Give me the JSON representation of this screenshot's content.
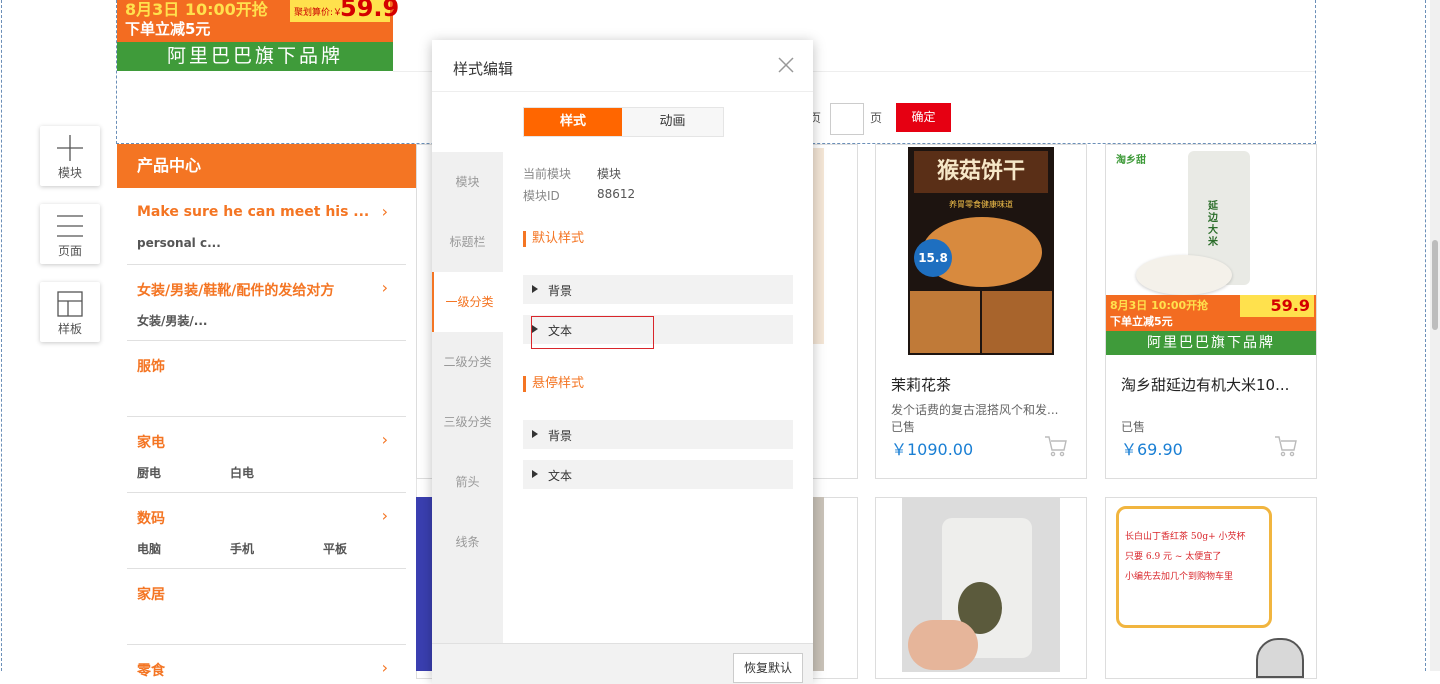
{
  "tools": [
    {
      "label": "模块",
      "icon": "plus-icon"
    },
    {
      "label": "页面",
      "icon": "page-lines-icon"
    },
    {
      "label": "样板",
      "icon": "layout-grid-icon"
    }
  ],
  "banner": {
    "line1": "8月3日 10:00开抢",
    "line2": "下单立减5元",
    "price_tag": "聚划算价:￥",
    "price": "59.9",
    "brand": "阿里巴巴旗下品牌"
  },
  "pager": {
    "suffix_char": "页",
    "unit": "页",
    "confirm": "确定",
    "input_value": ""
  },
  "category": {
    "header": "产品中心",
    "items": [
      {
        "title": "Make sure he can meet his ...",
        "subs": [
          "personal c..."
        ],
        "arrow": "›"
      },
      {
        "title": "女装/男装/鞋靴/配件的发给对方",
        "subs": [
          "女装/男装/..."
        ],
        "arrow": "›"
      },
      {
        "title": "服饰",
        "subs": [],
        "arrow": ""
      },
      {
        "title": "家电",
        "subs": [
          "厨电",
          "白电"
        ],
        "arrow": "›"
      },
      {
        "title": "数码",
        "subs": [
          "电脑",
          "手机",
          "平板"
        ],
        "arrow": "›"
      },
      {
        "title": "家居",
        "subs": [],
        "arrow": ""
      },
      {
        "title": "零食",
        "subs": [],
        "arrow": "›"
      }
    ]
  },
  "products": [
    {
      "name": "茉莉花茶",
      "desc": "发个话费的复古混搭风个和发...",
      "sold": "已售",
      "price": "￥1090.00",
      "img_title": "猴菇饼干",
      "img_sub": "养胃零食健康味道",
      "img_badge": "15.8"
    },
    {
      "name": "淘乡甜延边有机大米10...",
      "desc": "",
      "sold": "已售",
      "price": "￥69.90",
      "img_brand": "淘乡甜",
      "img_bag": "延边大米",
      "img_line1": "8月3日 10:00开抢",
      "img_line2": "下单立减5元",
      "img_price": "59.9",
      "img_brandline": "阿里巴巴旗下品牌"
    },
    {
      "name": "",
      "desc": "",
      "sold": "",
      "price": ""
    },
    {
      "name": "",
      "desc": "",
      "sold": "",
      "price": "",
      "note_lines": [
        "长白山丁香红茶 50g+ 小芡杯",
        "只要 6.9 元 ~ 太便宜了",
        "小编先去加几个到购物车里"
      ]
    }
  ],
  "modal": {
    "title": "样式编辑",
    "tabs": [
      "样式",
      "动画"
    ],
    "side_items": [
      "模块",
      "标题栏",
      "一级分类",
      "二级分类",
      "三级分类",
      "箭头",
      "线条"
    ],
    "active_side": "一级分类",
    "info": [
      {
        "key": "当前模块",
        "value": "模块"
      },
      {
        "key": "模块ID",
        "value": "88612"
      }
    ],
    "default_section": "默认样式",
    "default_items": [
      "背景",
      "文本"
    ],
    "hover_section": "悬停样式",
    "hover_items": [
      "背景",
      "文本"
    ],
    "reset": "恢复默认"
  },
  "colors": {
    "accent": "#f47523",
    "confirm": "#e60012",
    "price": "#1a7fd4",
    "tab_active": "#ff6600"
  }
}
